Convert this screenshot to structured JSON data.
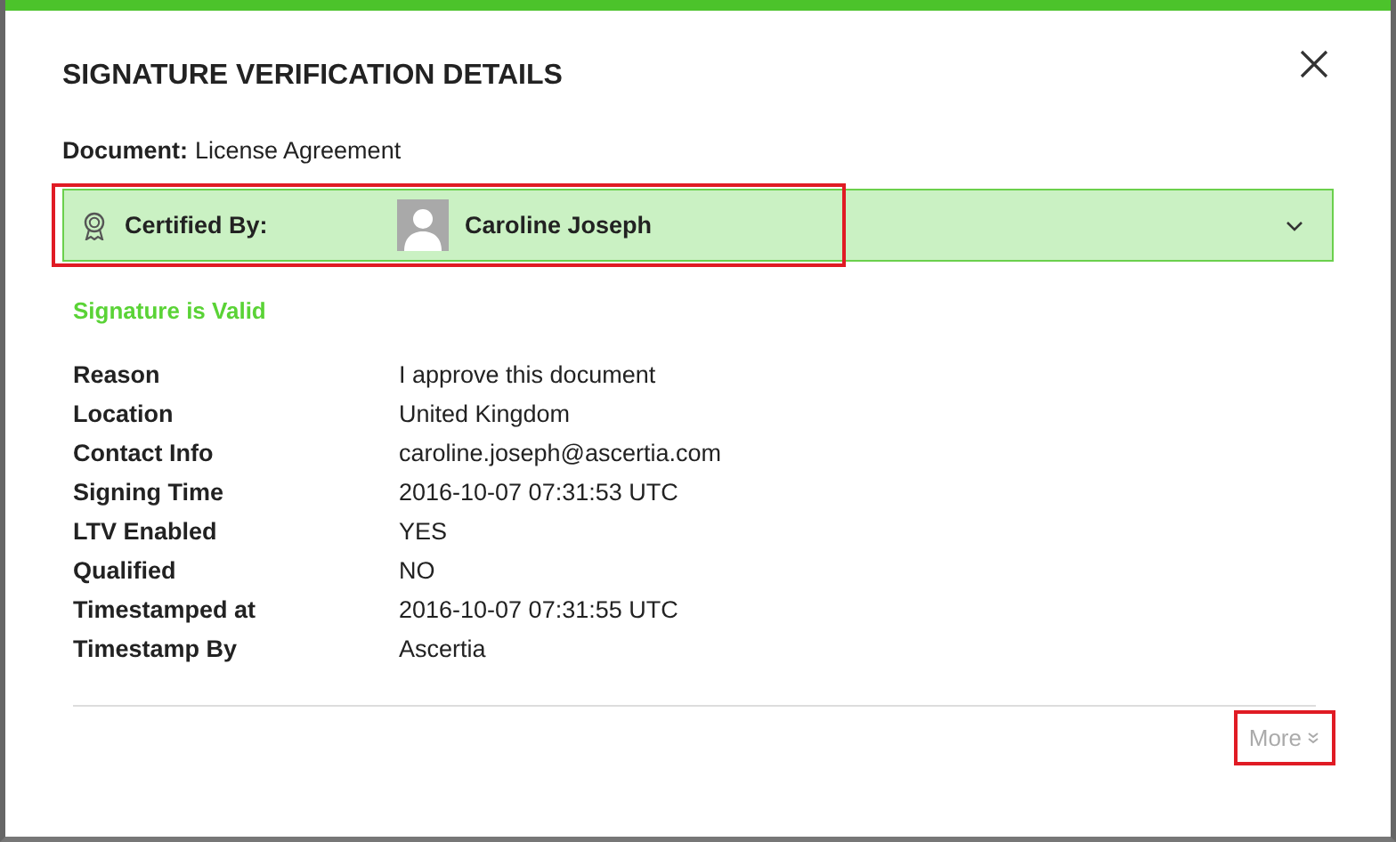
{
  "dialog": {
    "title": "SIGNATURE VERIFICATION DETAILS",
    "document_label": "Document:",
    "document_name": "License Agreement"
  },
  "signer_panel": {
    "label": "Certified By:",
    "name": "Caroline Joseph",
    "expanded": false,
    "highlighted": true
  },
  "status": "Signature is Valid",
  "details": [
    {
      "label": "Reason",
      "value": "I approve this document"
    },
    {
      "label": "Location",
      "value": "United Kingdom"
    },
    {
      "label": "Contact Info",
      "value": "caroline.joseph@ascertia.com"
    },
    {
      "label": "Signing Time",
      "value": "2016-10-07 07:31:53 UTC"
    },
    {
      "label": "LTV Enabled",
      "value": "YES"
    },
    {
      "label": "Qualified",
      "value": "NO"
    },
    {
      "label": "Timestamped at",
      "value": "2016-10-07 07:31:55 UTC"
    },
    {
      "label": "Timestamp By",
      "value": "Ascertia"
    }
  ],
  "more_link": {
    "label": "More",
    "highlighted": true
  }
}
